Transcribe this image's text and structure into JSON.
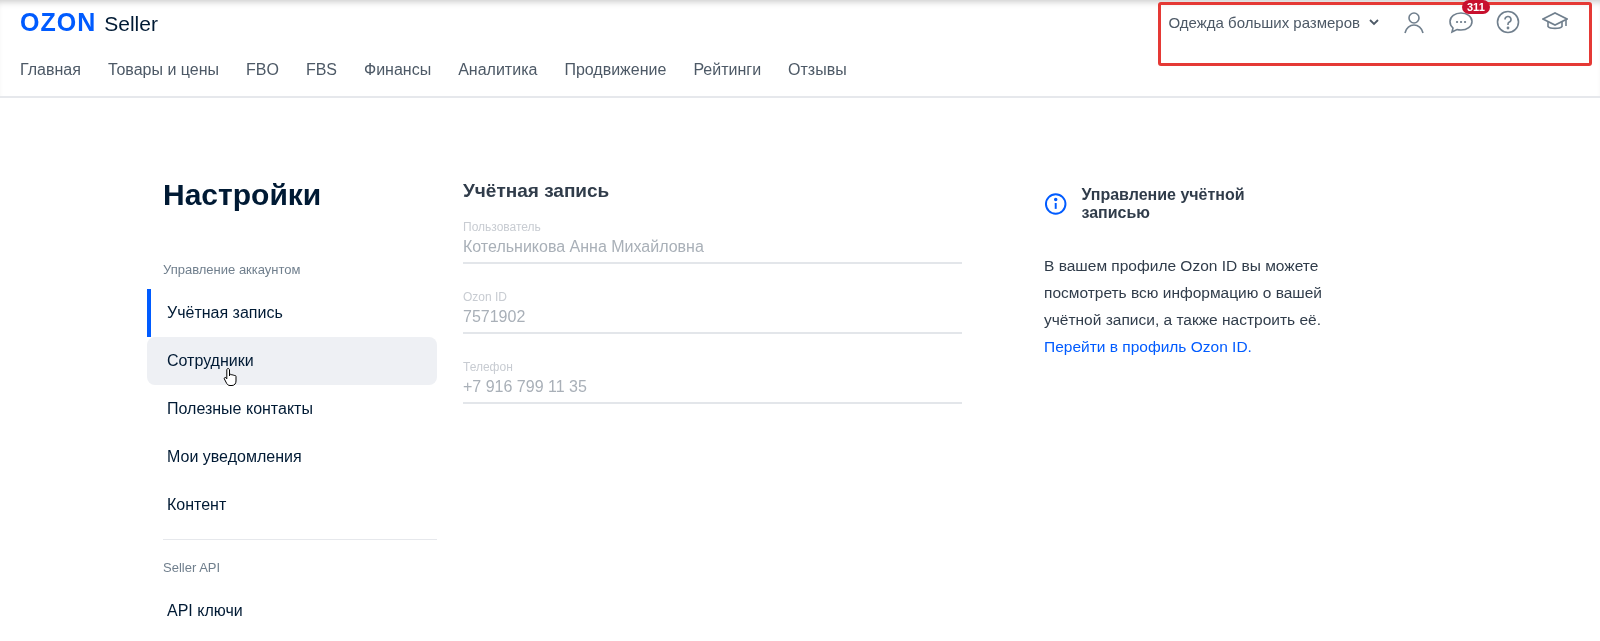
{
  "header": {
    "logo": {
      "brand": "OZON",
      "product": "Seller"
    },
    "store": "Одежда больших размеров",
    "notifications_badge": "311",
    "nav": [
      "Главная",
      "Товары и цены",
      "FBO",
      "FBS",
      "Финансы",
      "Аналитика",
      "Продвижение",
      "Рейтинги",
      "Отзывы"
    ]
  },
  "highlight": true,
  "page_title": "Настройки",
  "sidebar": {
    "sections": [
      {
        "heading": "Управление аккаунтом",
        "items": [
          {
            "label": "Учётная запись",
            "selected": true,
            "hovered": false
          },
          {
            "label": "Сотрудники",
            "selected": false,
            "hovered": true
          },
          {
            "label": "Полезные контакты",
            "selected": false,
            "hovered": false
          },
          {
            "label": "Мои уведомления",
            "selected": false,
            "hovered": false
          },
          {
            "label": "Контент",
            "selected": false,
            "hovered": false
          }
        ]
      },
      {
        "heading": "Seller API",
        "items": [
          {
            "label": "API ключи",
            "selected": false,
            "hovered": false
          }
        ]
      }
    ]
  },
  "account": {
    "title": "Учётная запись",
    "fields": [
      {
        "label": "Пользователь",
        "value": "Котельникова Анна Михайловна"
      },
      {
        "label": "Ozon ID",
        "value": "7571902"
      },
      {
        "label": "Телефон",
        "value": "+7 916 799 11 35"
      }
    ]
  },
  "info": {
    "title": "Управление учётной записью",
    "text": "В вашем профиле Ozon ID вы можете посмотреть всю информацию о вашей учётной записи, а также настроить её.",
    "link": "Перейти в профиль Ozon ID."
  }
}
